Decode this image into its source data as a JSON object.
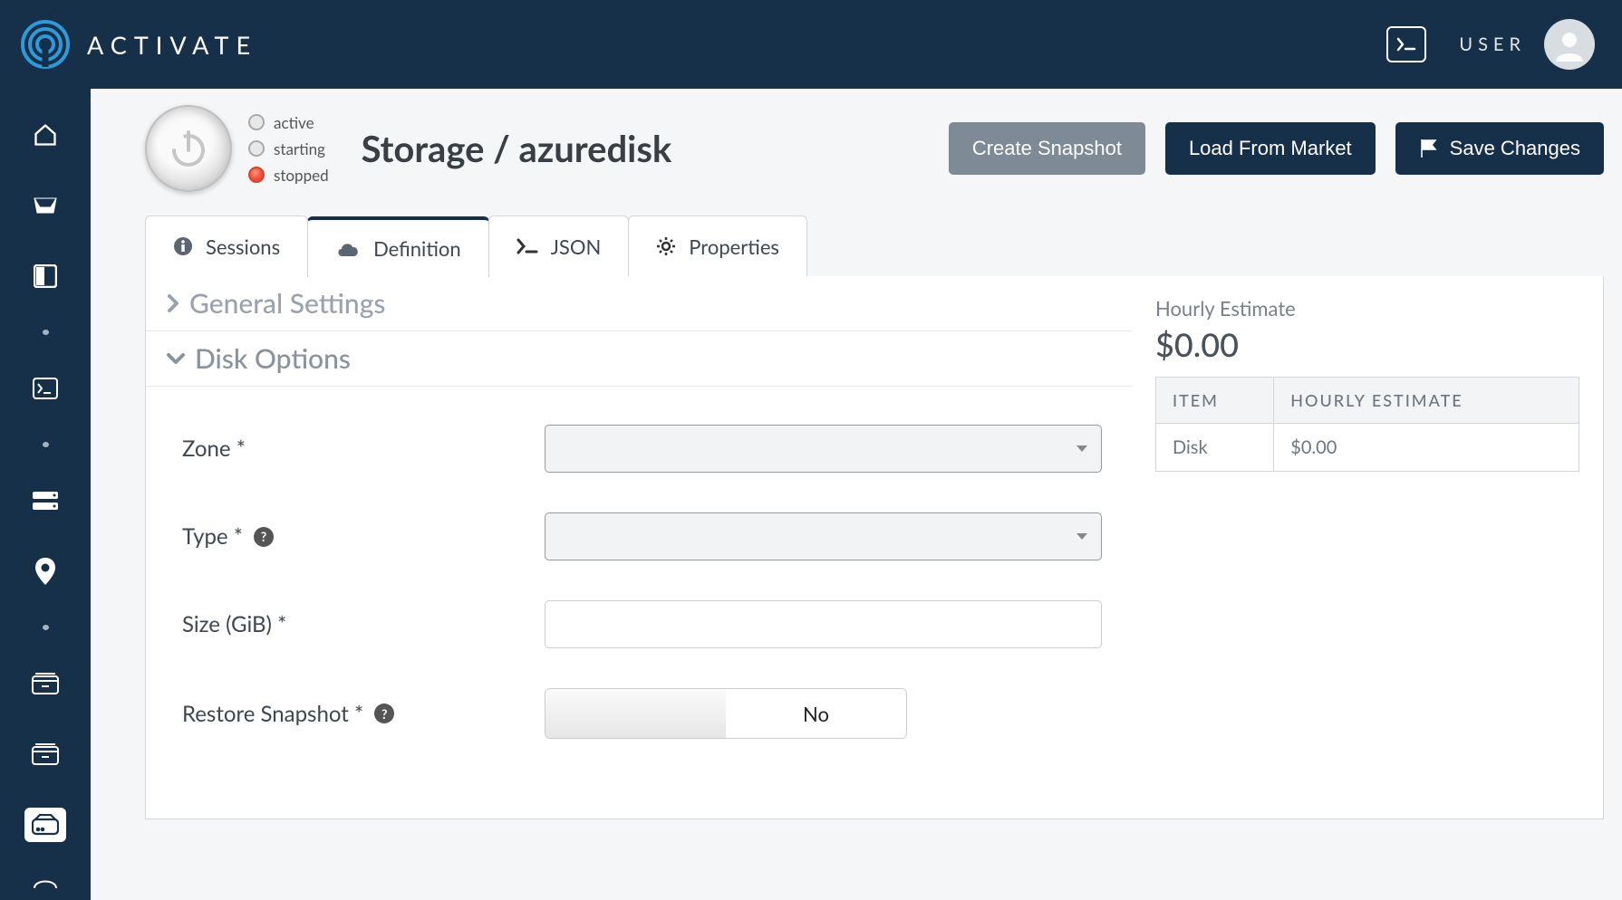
{
  "header": {
    "brand": "ACTIVATE",
    "user_label": "USER"
  },
  "statuses": {
    "active": "active",
    "starting": "starting",
    "stopped": "stopped"
  },
  "page_title": "Storage / azuredisk",
  "buttons": {
    "create_snapshot": "Create Snapshot",
    "load_market": "Load From Market",
    "save_changes": "Save Changes"
  },
  "tabs": {
    "sessions": "Sessions",
    "definition": "Definition",
    "json": "JSON",
    "properties": "Properties"
  },
  "sections": {
    "general": "General Settings",
    "disk": "Disk Options"
  },
  "form": {
    "zone_label": "Zone *",
    "zone_value": "",
    "type_label": "Type *",
    "type_value": "",
    "size_label": "Size (GiB) *",
    "size_value": "",
    "restore_label": "Restore Snapshot *",
    "restore_value": "No"
  },
  "estimate": {
    "title": "Hourly Estimate",
    "total": "$0.00",
    "col_item": "ITEM",
    "col_hourly": "HOURLY ESTIMATE",
    "rows": [
      {
        "item": "Disk",
        "hourly": "$0.00"
      }
    ]
  }
}
